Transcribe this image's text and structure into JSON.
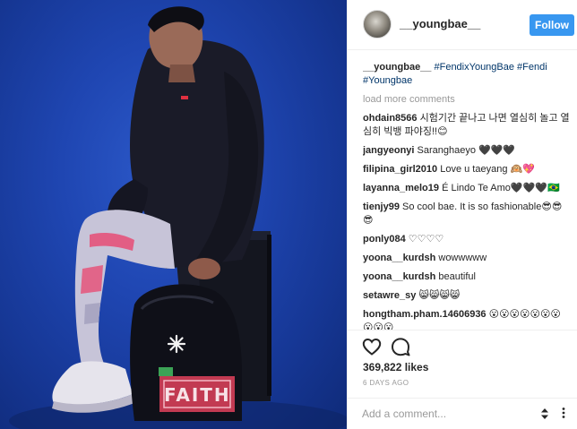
{
  "post": {
    "username": "__youngbae__",
    "follow_label": "Follow",
    "photo_text": "FAITH",
    "caption": {
      "user": "__youngbae__",
      "text": "#FendixYoungBae #Fendi #Youngbae"
    },
    "load_more": "load more comments",
    "comments": [
      {
        "user": "ohdain8566",
        "text": "시험기간 끝나고 나면 열심히 놀고 열심히 빅뱅 파야징!!😊"
      },
      {
        "user": "jangyeonyi",
        "text": "Saranghaeyo 🖤🖤🖤"
      },
      {
        "user": "filipina_girl2010",
        "text": "Love u taeyang 🙉💖"
      },
      {
        "user": "layanna_melo19",
        "text": "É Lindo Te Amo🖤🖤🖤🇧🇷"
      },
      {
        "user": "tienjy99",
        "text": "So cool bae. It is so fashionable😎😎😎"
      },
      {
        "user": "ponly084",
        "text": "♡♡♡♡"
      },
      {
        "user": "yoona__kurdsh",
        "text": "wowwwww"
      },
      {
        "user": "yoona__kurdsh",
        "text": "beautiful"
      },
      {
        "user": "setawre_sy",
        "text": "😸😸😸😸"
      },
      {
        "user": "hongtham.pham.14606936",
        "text": "😮😮😮😮😮😮😮😮😮😮"
      }
    ],
    "likes": "369,822 likes",
    "time": "6 DAYS AGO",
    "add_comment_placeholder": "Add a comment...",
    "icons": {
      "like": "heart-icon",
      "comment": "comment-bubble-icon",
      "sort": "sort-arrows-icon",
      "more": "more-options-icon"
    },
    "colors": {
      "follow_bg": "#3897f0",
      "hashtag": "#003569",
      "photo_bg": "#1f46b2"
    }
  }
}
